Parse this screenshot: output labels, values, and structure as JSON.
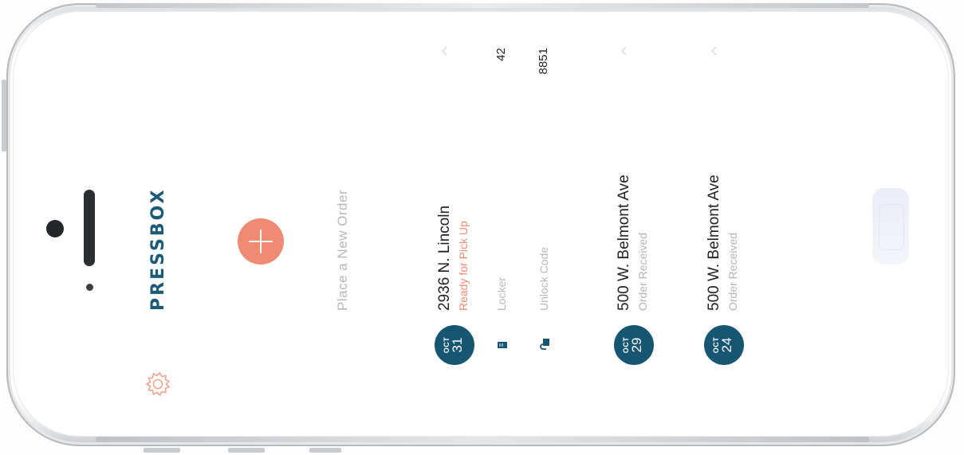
{
  "app": {
    "brand": "PRESSBOX"
  },
  "new_order": {
    "label": "Place a New Order"
  },
  "orders": [
    {
      "month": "OCT",
      "day": "31",
      "address": "2936 N. Lincoln",
      "status": "Ready for Pick Up",
      "details": [
        {
          "label": "Locker",
          "value": "42",
          "icon": "locker-icon"
        },
        {
          "label": "Unlock Code",
          "value": "8851",
          "icon": "unlock-icon"
        }
      ]
    },
    {
      "month": "OCT",
      "day": "29",
      "address": "500 W. Belmont Ave",
      "status": "Order Received"
    },
    {
      "month": "OCT",
      "day": "24",
      "address": "500 W. Belmont Ave",
      "status": "Order Received"
    }
  ],
  "colors": {
    "brand": "#1c5b78",
    "accent": "#ef8a73",
    "badge": "#165673",
    "muted": "#b5b8bb"
  },
  "icons": [
    "gear-icon",
    "plus-icon",
    "chevron-up-icon",
    "locker-icon",
    "unlock-icon"
  ]
}
